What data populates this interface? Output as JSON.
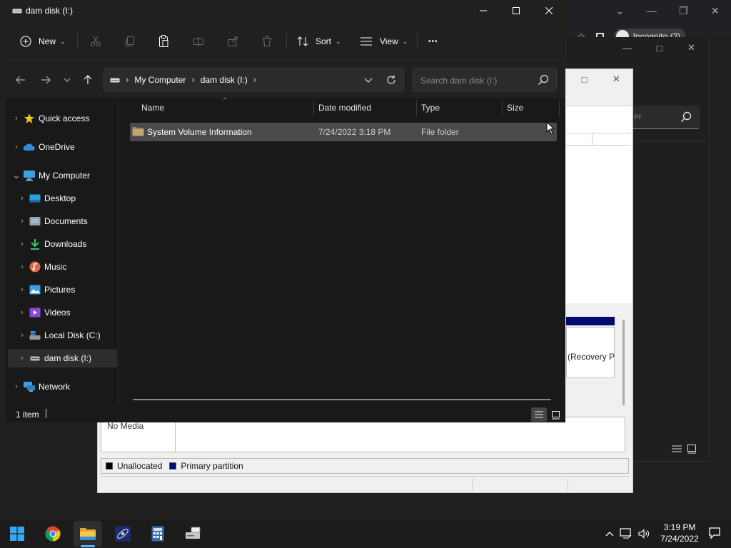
{
  "browser": {
    "profile_label": "Incognito (2)"
  },
  "settings_window": {
    "search_placeholder_fragment": "er"
  },
  "disk_management": {
    "partition_label": "(Recovery P",
    "no_media_label": "No Media",
    "legend": [
      {
        "label": "Unallocated",
        "color": "#000000"
      },
      {
        "label": "Primary partition",
        "color": "#000a70"
      }
    ]
  },
  "explorer": {
    "title": "dam disk (I:)",
    "commands": {
      "new_label": "New",
      "sort_label": "Sort",
      "view_label": "View",
      "more_label": "•••"
    },
    "address": {
      "crumbs": [
        "My Computer",
        "dam disk (I:)"
      ]
    },
    "search": {
      "placeholder": "Search dam disk (I:)"
    },
    "sidebar": {
      "items": [
        {
          "label": "Quick access",
          "icon": "star-icon",
          "color": "#f5c518"
        },
        {
          "label": "OneDrive",
          "icon": "cloud-icon",
          "color": "#2f8fe0"
        },
        {
          "label": "My Computer",
          "icon": "computer-icon",
          "color": "#3aa0e8"
        },
        {
          "label": "Desktop",
          "icon": "desktop-icon",
          "color": "#2fa0d8"
        },
        {
          "label": "Documents",
          "icon": "documents-icon",
          "color": "#8aa4b8"
        },
        {
          "label": "Downloads",
          "icon": "download-icon",
          "color": "#3cc46a"
        },
        {
          "label": "Music",
          "icon": "music-icon",
          "color": "#e0684a"
        },
        {
          "label": "Pictures",
          "icon": "pictures-icon",
          "color": "#3a9fe0"
        },
        {
          "label": "Videos",
          "icon": "videos-icon",
          "color": "#8a4ad8"
        },
        {
          "label": "Local Disk (C:)",
          "icon": "windows-drive-icon",
          "color": "#3aa0e8"
        },
        {
          "label": "dam disk (I:)",
          "icon": "drive-icon",
          "color": "#bbbbbb"
        },
        {
          "label": "Network",
          "icon": "network-icon",
          "color": "#3aa0e8"
        }
      ]
    },
    "columns": {
      "name": "Name",
      "date": "Date modified",
      "type": "Type",
      "size": "Size"
    },
    "rows": [
      {
        "name": "System Volume Information",
        "date": "7/24/2022 3:18 PM",
        "type": "File folder",
        "size": ""
      }
    ],
    "status": {
      "item_count": "1 item"
    }
  },
  "taskbar": {
    "apps": [
      "start-icon",
      "chrome-icon",
      "file-explorer-icon",
      "galaxy-app-icon",
      "calculator-icon",
      "disk-tool-icon"
    ],
    "clock": {
      "time": "3:19 PM",
      "date": "7/24/2022"
    }
  }
}
